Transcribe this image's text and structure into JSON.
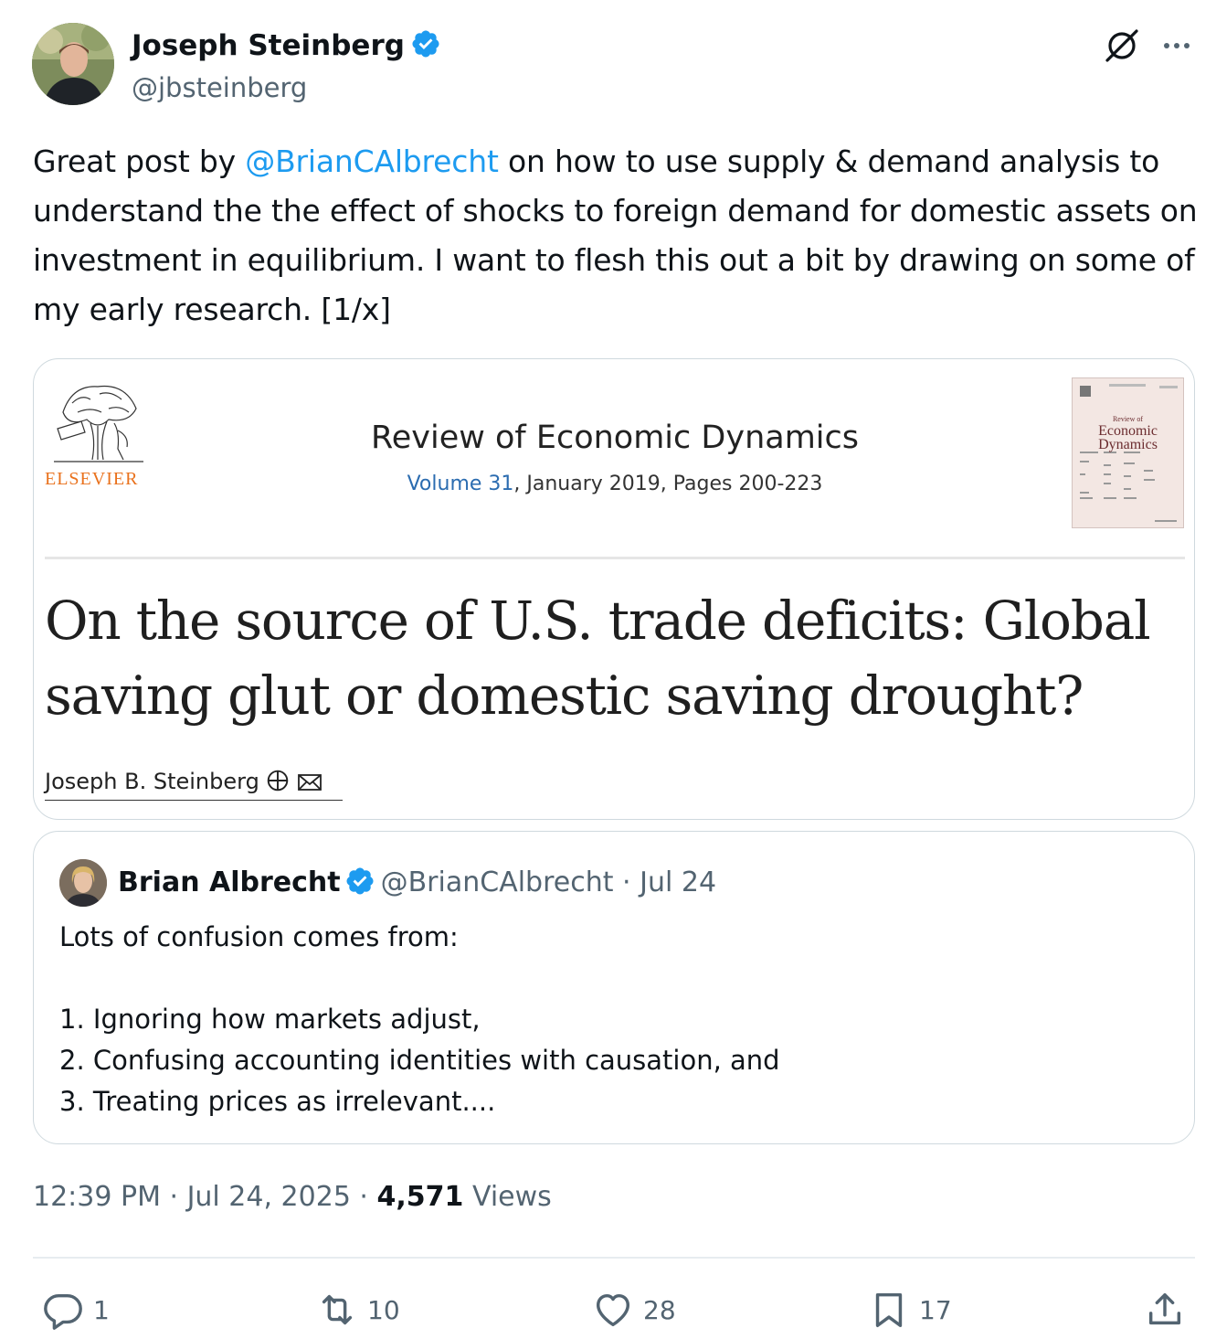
{
  "author": {
    "name": "Joseph Steinberg",
    "handle": "@jbsteinberg"
  },
  "tweet": {
    "text_before": "Great post by ",
    "mention": "@BrianCAlbrecht",
    "text_after": " on how to use supply & demand analysis to understand the the effect of shocks to foreign demand for domestic assets on investment in equilibrium. I want to flesh this out a bit by drawing on some of my early research. [1/x]"
  },
  "card": {
    "publisher": "ELSEVIER",
    "journal": "Review of Economic Dynamics",
    "volume_link": "Volume 31",
    "volume_rest": ", January 2019, Pages 200-223",
    "cover_small": "Review of",
    "cover_line1": "Economic",
    "cover_line2": "Dynamics",
    "title": "On the source of U.S. trade deficits: Global saving glut or domestic saving drought?",
    "author": "Joseph B. Steinberg"
  },
  "quote": {
    "name": "Brian Albrecht",
    "handle": "@BrianCAlbrecht",
    "date": "· Jul 24",
    "lines": [
      "Lots of confusion comes from:",
      "",
      "1. Ignoring how markets adjust,",
      "2. Confusing accounting identities with causation, and",
      "3. Treating prices as irrelevant...."
    ]
  },
  "meta": {
    "time_date": "12:39 PM · Jul 24, 2025 · ",
    "views_count": "4,571",
    "views_label": " Views"
  },
  "actions": {
    "replies": "1",
    "reposts": "10",
    "likes": "28",
    "bookmarks": "17"
  },
  "colors": {
    "accent": "#1d9bf0",
    "secondary_text": "#536471",
    "elsevier_orange": "#e9711c"
  }
}
